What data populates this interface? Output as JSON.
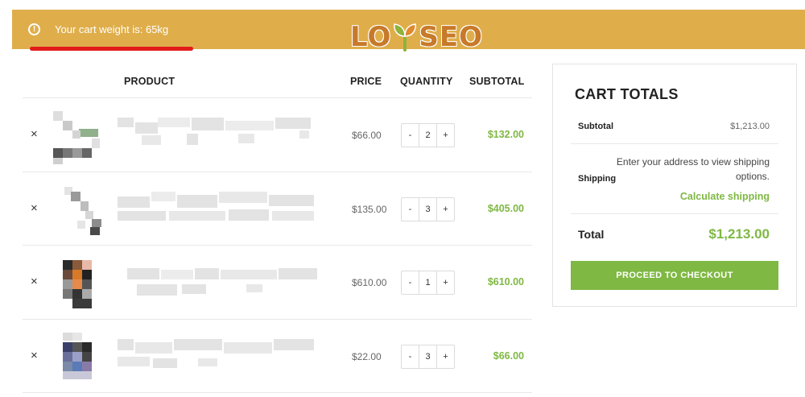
{
  "notice": {
    "text": "Your cart weight is: 65kg",
    "icon": "info-circle-icon",
    "background": "#dfae4b",
    "underline_color": "#e21b1b"
  },
  "logo": {
    "left_text": "LO",
    "right_text": "SEO",
    "color": "#c77a2a"
  },
  "table": {
    "headers": {
      "product": "PRODUCT",
      "price": "PRICE",
      "quantity": "QUANTITY",
      "subtotal": "SUBTOTAL"
    },
    "rows": [
      {
        "remove": "×",
        "price": "$66.00",
        "minus": "-",
        "qty": "2",
        "plus": "+",
        "subtotal": "$132.00"
      },
      {
        "remove": "×",
        "price": "$135.00",
        "minus": "-",
        "qty": "3",
        "plus": "+",
        "subtotal": "$405.00"
      },
      {
        "remove": "×",
        "price": "$610.00",
        "minus": "-",
        "qty": "1",
        "plus": "+",
        "subtotal": "$610.00"
      },
      {
        "remove": "×",
        "price": "$22.00",
        "minus": "-",
        "qty": "3",
        "plus": "+",
        "subtotal": "$66.00"
      }
    ]
  },
  "totals": {
    "title": "CART TOTALS",
    "subtotal_label": "Subtotal",
    "subtotal_value": "$1,213.00",
    "shipping_label": "Shipping",
    "shipping_note": "Enter your address to view shipping options.",
    "calculate_label": "Calculate shipping",
    "total_label": "Total",
    "total_value": "$1,213.00",
    "checkout_label": "PROCEED TO CHECKOUT"
  },
  "colors": {
    "accent": "#7fb843",
    "banner": "#dfae4b"
  }
}
